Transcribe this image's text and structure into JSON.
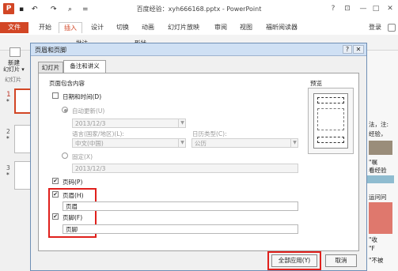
{
  "window": {
    "title": "百度经验：xyh666168.pptx - PowerPoint",
    "app_icon": "P",
    "help_btn": "?",
    "restore_btn": "⊡",
    "min_btn": "—",
    "max_btn": "□",
    "close_btn": "✕"
  },
  "qat": {
    "save": "💾",
    "undo": "↶",
    "redo": "↷",
    "more": "⌕",
    "dropdown": "="
  },
  "ribbon": {
    "tabs": [
      "文件",
      "开始",
      "插入",
      "设计",
      "切换",
      "动画",
      "幻灯片放映",
      "审阅",
      "视图",
      "福昕阅读器"
    ],
    "login": "登录",
    "fragments": [
      "批注",
      "形状"
    ]
  },
  "left_panel": {
    "new_slide_l1": "新建",
    "new_slide_l2": "幻灯片 ▾",
    "group_label": "幻灯片",
    "slides": [
      "1",
      "2",
      "3"
    ],
    "star": "*"
  },
  "right_fragments": [
    "法，注:",
    "经验，",
    "\"嘱",
    "看经验",
    "运问问",
    "\"收",
    "\"F",
    "\"不被"
  ],
  "dialog": {
    "title": "页眉和页脚",
    "help": "?",
    "close": "✕",
    "tabs": [
      "幻灯片",
      "备注和讲义"
    ],
    "section": "页面包含内容",
    "date_time_label": "日期和时间(D)",
    "auto_update_label": "自动更新(U)",
    "date_value": "2013/12/3",
    "language_label": "语言(国家/地区)(L):",
    "language_value": "中文(中国)",
    "calendar_label": "日历类型(C):",
    "calendar_value": "公历",
    "fixed_label": "固定(X)",
    "fixed_value": "2013/12/3",
    "page_number_label": "页码(P)",
    "header_label": "页眉(H)",
    "header_value": "页眉",
    "footer_label": "页脚(F)",
    "footer_value": "页脚",
    "preview_label": "预览",
    "apply_all": "全部应用(Y)",
    "cancel": "取消",
    "states": {
      "date_time": false,
      "page_number": true,
      "header": true,
      "footer": true,
      "auto_update": true
    }
  },
  "colors": {
    "accent": "#d24625",
    "highlight": "#e0201c",
    "dialog_title": "#cfe0f4"
  }
}
